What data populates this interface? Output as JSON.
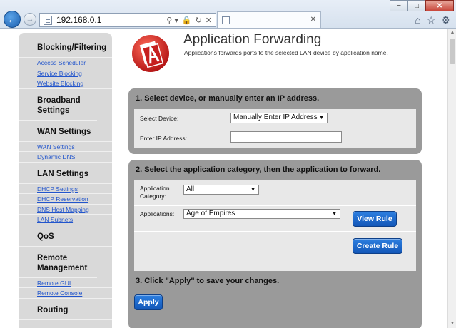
{
  "browser": {
    "url": "192.168.0.1",
    "tab_title": "",
    "tab_close": "✕",
    "window_controls": {
      "minimize": "−",
      "maximize": "□",
      "close": "✕"
    },
    "addr_icons": [
      "⚲ ▾",
      "🔒",
      "↻",
      "✕"
    ],
    "toolbar_icons": {
      "home": "⌂",
      "favorites": "☆",
      "settings": "⚙"
    }
  },
  "sidebar": {
    "sections": [
      {
        "heading": "Blocking/Filtering",
        "links": [
          "Access Scheduler",
          "Service Blocking",
          "Website Blocking"
        ]
      },
      {
        "heading": "Broadband Settings",
        "links": []
      },
      {
        "heading": "WAN Settings",
        "links": [
          "WAN Settings",
          "Dynamic DNS"
        ]
      },
      {
        "heading": "LAN Settings",
        "links": [
          "DHCP Settings",
          "DHCP Reservation",
          "DNS Host Mapping",
          "LAN Subnets"
        ]
      },
      {
        "heading": "QoS",
        "links": []
      },
      {
        "heading": "Remote Management",
        "links": [
          "Remote GUI",
          "Remote Console"
        ]
      },
      {
        "heading": "Routing",
        "links": []
      }
    ]
  },
  "header": {
    "title": "Application Forwarding",
    "subtitle": "Applications forwards ports to the selected LAN device by application name."
  },
  "step1": {
    "title": "1. Select device, or manually enter an IP address.",
    "device_label": "Select Device:",
    "device_value": "Manually Enter IP Address",
    "ip_label": "Enter IP Address:",
    "ip_value": ""
  },
  "step2": {
    "title": "2. Select the application category, then the application to forward.",
    "category_label_line1": "Application",
    "category_label_line2": "Category:",
    "category_value": "All",
    "applications_label": "Applications:",
    "applications_value": "Age of Empires",
    "view_rule_label": "View Rule",
    "create_rule_label": "Create Rule"
  },
  "step3": {
    "title": "3. Click \"Apply\" to save your changes.",
    "apply_label": "Apply"
  },
  "colors": {
    "panel_bg": "#9a9a9a",
    "panel_inner_bg": "#e8e8e8",
    "sidebar_bg": "#d9d9d9",
    "button_blue": "#1a66cc",
    "link_blue": "#2255cc",
    "logo_red": "#d42a2a"
  }
}
